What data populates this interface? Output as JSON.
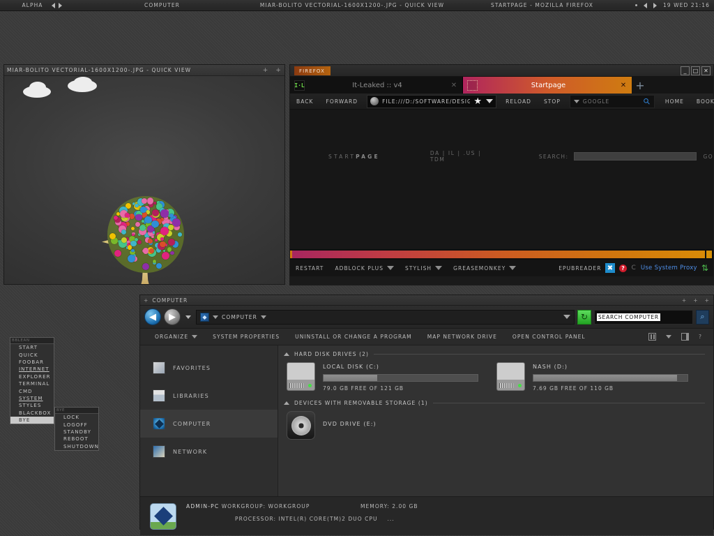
{
  "taskbar": {
    "workspace": "ALPHA",
    "items": [
      "COMPUTER",
      "MIAR-BOLITO VECTORIAL-1600X1200-.JPG - QUICK VIEW",
      "STARTPAGE - MOZILLA FIREFOX"
    ],
    "clock": "19 WED 21:16"
  },
  "image_viewer": {
    "title": "MIAR-BOLITO VECTORIAL-1600X1200-.JPG - QUICK VIEW",
    "btn_minimize": "+",
    "btn_close": "+"
  },
  "firefox": {
    "badge": "FIREFOX",
    "window_buttons": {
      "minimize": "_",
      "maximize": "□",
      "close": "✕"
    },
    "tabs": [
      {
        "label": "It-Leaked :: v4",
        "favicon": "itleaked-favicon",
        "favicon_text": "I·L",
        "close": "✕",
        "active": false
      },
      {
        "label": "Startpage",
        "favicon": "startpage-favicon",
        "favicon_text": "",
        "close": "✕",
        "active": true
      }
    ],
    "new_tab": "+",
    "toolbar": {
      "back": "BACK",
      "forward": "FORWARD",
      "url": "FILE:///D:/SOFTWARE/DESIG",
      "reload": "RELOAD",
      "stop": "STOP",
      "search_engine": "GOOGLE",
      "home": "HOME",
      "bookmarks": "BOOKMARKS"
    },
    "page": {
      "logo_pre": "START",
      "logo_bold": "PAGE",
      "languages": "DA  |  IL  |  .US  |  TDM",
      "search_label": "SEARCH:",
      "search_value": "",
      "go": "GO"
    },
    "status": {
      "restart": "RESTART",
      "adblock": "ADBLOCK PLUS",
      "stylish": "STYLISH",
      "greasemonkey": "GREASEMONKEY",
      "epubreader": "EPUBREADER",
      "icon_x": "✖",
      "icon_q": "?",
      "icon_c": "C",
      "proxy": "Use System Proxy"
    }
  },
  "explorer": {
    "title": "COMPUTER",
    "title_plus": "+",
    "title_buttons": [
      "+",
      "+",
      "+"
    ],
    "nav": {
      "back": "◀",
      "forward": "▶",
      "address_icon": "computer-icon",
      "breadcrumb": "COMPUTER",
      "refresh": "↻",
      "search_value": "SEARCH COMPUTER",
      "search_go": "⌕"
    },
    "toolbar": [
      "ORGANIZE",
      "SYSTEM PROPERTIES",
      "UNINSTALL OR CHANGE A PROGRAM",
      "MAP NETWORK DRIVE",
      "OPEN CONTROL PANEL"
    ],
    "toolbar_help": "?",
    "sidebar": [
      {
        "label": "FAVORITES",
        "icon": "favorites-icon",
        "selected": false
      },
      {
        "label": "LIBRARIES",
        "icon": "libraries-icon",
        "selected": false
      },
      {
        "label": "COMPUTER",
        "icon": "computer-icon",
        "selected": true
      },
      {
        "label": "NETWORK",
        "icon": "network-icon",
        "selected": false
      }
    ],
    "groups": [
      {
        "header": "HARD DISK DRIVES (2)",
        "drives": [
          {
            "name": "LOCAL DISK (C:)",
            "free_text": "79.0 GB FREE OF 121 GB",
            "used_percent": 35
          },
          {
            "name": "NASH (D:)",
            "free_text": "7.69 GB FREE OF 110 GB",
            "used_percent": 93
          }
        ]
      },
      {
        "header": "DEVICES WITH REMOVABLE STORAGE (1)",
        "drives": [
          {
            "name": "DVD DRIVE (E:)",
            "free_text": "",
            "used_percent": 0
          }
        ]
      }
    ],
    "status": {
      "pc_name": "ADMIN-PC",
      "workgroup_label": "WORKGROUP: WORKGROUP",
      "memory": "MEMORY: 2.00 GB",
      "processor": "PROCESSOR: INTEL(R) CORE(TM)2 DUO CPU",
      "processor_more": "..."
    }
  },
  "root_menu": {
    "title": "BBLEAN",
    "items": [
      {
        "label": "START",
        "underline": false,
        "selected": false
      },
      {
        "label": "QUICK",
        "underline": false,
        "selected": false
      },
      {
        "label": "FOOBAR",
        "underline": false,
        "selected": false
      },
      {
        "label": "INTERNET",
        "underline": true,
        "selected": false
      },
      {
        "label": "EXPLORER",
        "underline": false,
        "selected": false
      },
      {
        "label": "TERMINAL",
        "underline": false,
        "selected": false
      },
      {
        "label": "CMD",
        "underline": false,
        "selected": false
      },
      {
        "label": "SYSTEM",
        "underline": true,
        "selected": false
      },
      {
        "label": "STYLES",
        "underline": false,
        "selected": false
      },
      {
        "label": "BLACKBOX",
        "underline": false,
        "selected": false
      },
      {
        "label": "BYE",
        "underline": false,
        "selected": true
      }
    ]
  },
  "bye_menu": {
    "title": "BYE",
    "items": [
      {
        "label": "LOCK"
      },
      {
        "label": "LOGOFF"
      },
      {
        "label": "STANDBY"
      },
      {
        "label": "REBOOT"
      },
      {
        "label": "SHUTDOWN"
      }
    ]
  }
}
